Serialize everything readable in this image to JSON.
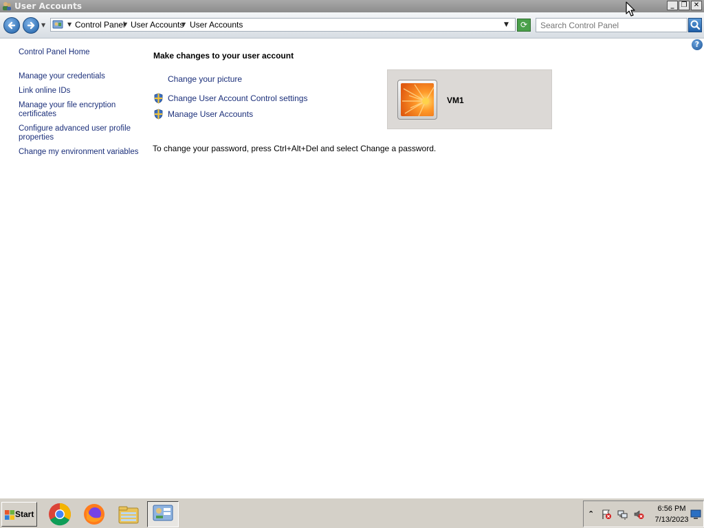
{
  "window": {
    "title": "User Accounts",
    "caption_buttons": {
      "minimize": "_",
      "maximize": "❐",
      "close": "✕"
    }
  },
  "address_bar": {
    "breadcrumbs": [
      "Control Panel",
      "User Accounts",
      "User Accounts"
    ],
    "search_placeholder": "Search Control Panel"
  },
  "left_pane": {
    "home": "Control Panel Home",
    "links": [
      "Manage your credentials",
      "Link online IDs",
      "Manage your file encryption certificates",
      "Configure advanced user profile properties",
      "Change my environment variables"
    ]
  },
  "main": {
    "heading": "Make changes to your user account",
    "links": [
      "Change your picture",
      "Change User Account Control settings",
      "Manage User Accounts"
    ],
    "password_note": "To change your password, press Ctrl+Alt+Del and select Change a password.",
    "user": {
      "name": "VM1"
    }
  },
  "taskbar": {
    "start_label": "Start",
    "apps": [
      "chrome-icon",
      "firefox-icon",
      "file-explorer-icon",
      "control-panel-icon"
    ],
    "clock": {
      "time": "6:56 PM",
      "date": "7/13/2023"
    }
  },
  "colors": {
    "link": "#1b2f7a",
    "title_bar": "#9b9b9b",
    "taskbar": "#d4d0c8",
    "user_card": "#dcd9d6"
  }
}
